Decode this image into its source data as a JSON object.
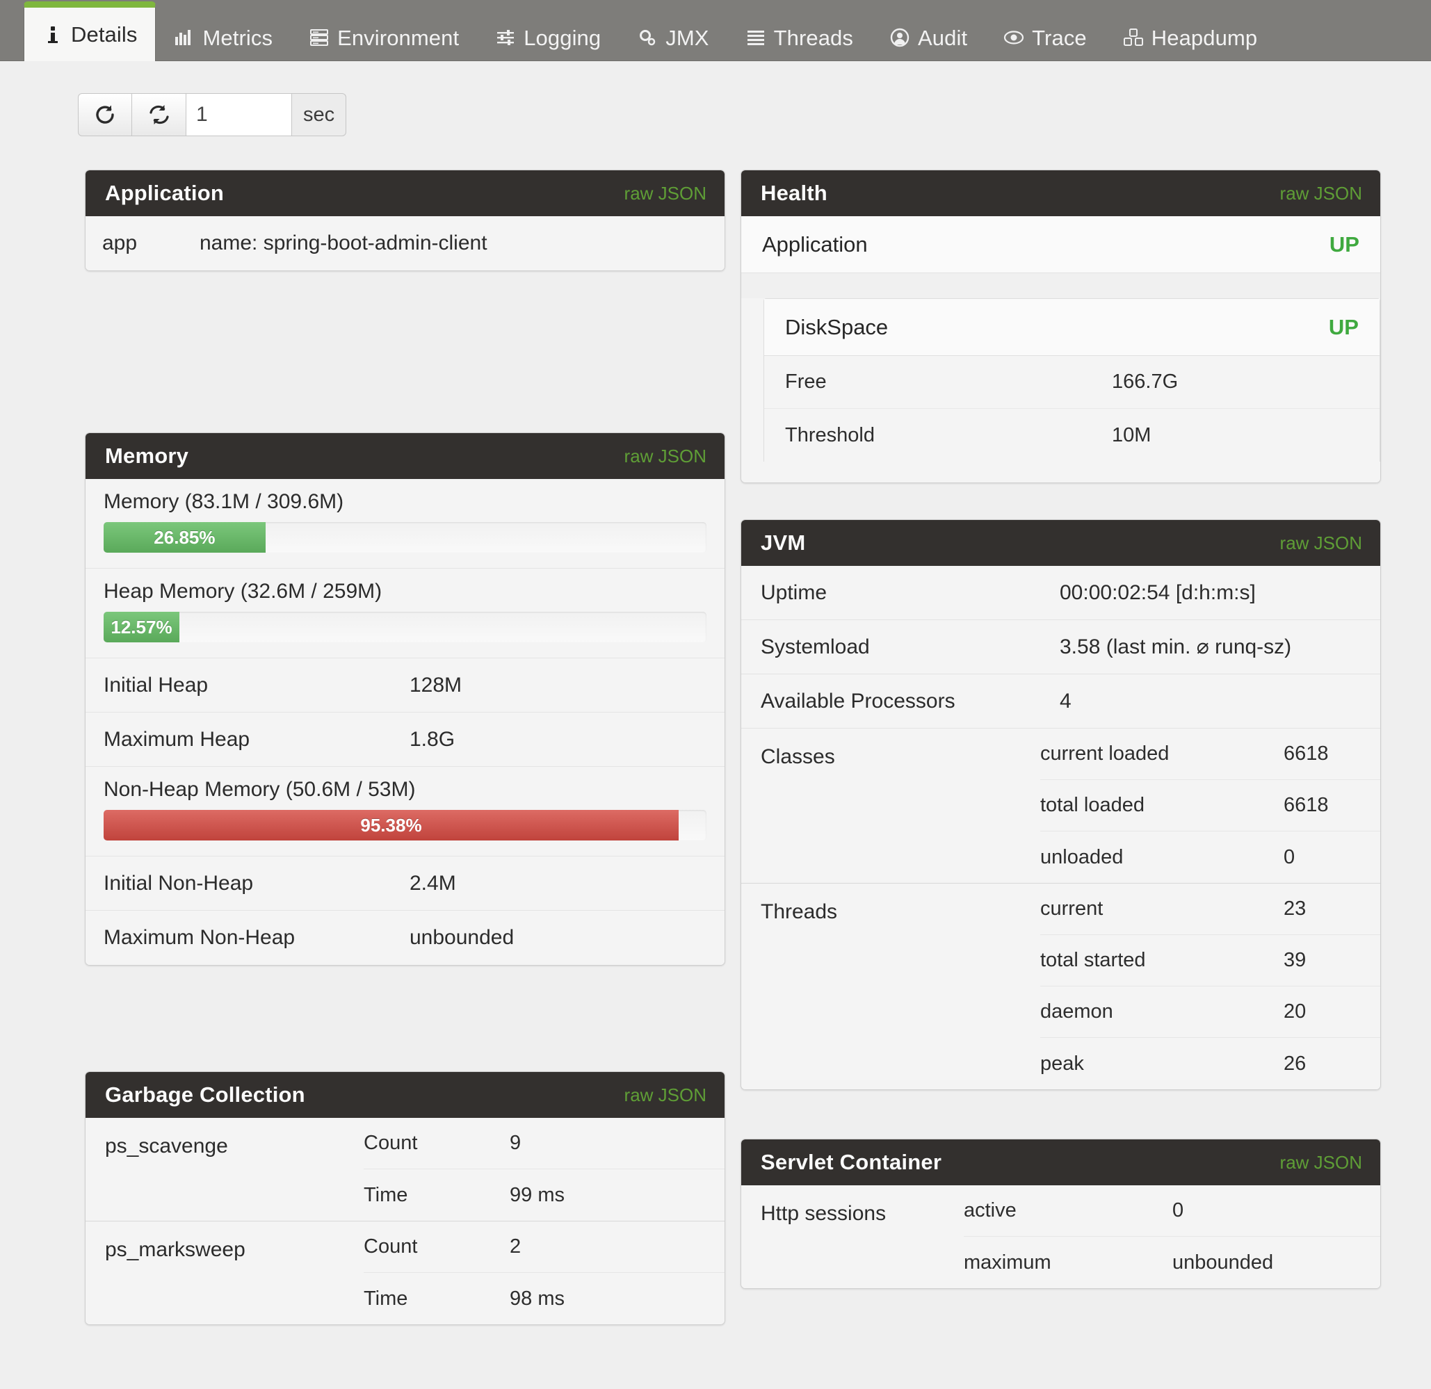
{
  "tabs": [
    {
      "label": "Details",
      "icon": "info-icon",
      "active": true
    },
    {
      "label": "Metrics",
      "icon": "bar-chart-icon",
      "active": false
    },
    {
      "label": "Environment",
      "icon": "server-icon",
      "active": false
    },
    {
      "label": "Logging",
      "icon": "sliders-icon",
      "active": false
    },
    {
      "label": "JMX",
      "icon": "gears-icon",
      "active": false
    },
    {
      "label": "Threads",
      "icon": "list-icon",
      "active": false
    },
    {
      "label": "Audit",
      "icon": "user-circle-icon",
      "active": false
    },
    {
      "label": "Trace",
      "icon": "eye-icon",
      "active": false
    },
    {
      "label": "Heapdump",
      "icon": "cubes-icon",
      "active": false
    }
  ],
  "toolbar": {
    "refresh_icon": "refresh-icon",
    "autorefresh_icon": "auto-refresh-icon",
    "interval_value": "1",
    "interval_placeholder": "1",
    "interval_unit": "sec"
  },
  "raw_json_label": "raw JSON",
  "colors": {
    "accent_green": "#7fb73e",
    "status_up": "#3fa93f",
    "raw_json": "#5f9e36",
    "panel_header": "#33302e",
    "bar_green": "#5aa95a",
    "bar_red": "#c0433c"
  },
  "panels": {
    "application": {
      "title": "Application",
      "row": {
        "key": "app",
        "value": "name: spring-boot-admin-client"
      }
    },
    "health": {
      "title": "Health",
      "application": {
        "label": "Application",
        "status": "UP"
      },
      "diskspace": {
        "label": "DiskSpace",
        "status": "UP",
        "details": [
          {
            "key": "Free",
            "value": "166.7G"
          },
          {
            "key": "Threshold",
            "value": "10M"
          }
        ]
      }
    },
    "memory": {
      "title": "Memory",
      "bars": [
        {
          "label": "Memory (83.1M / 309.6M)",
          "percent_label": "26.85%",
          "percent": 26.85,
          "color": "green"
        },
        {
          "label": "Heap Memory (32.6M / 259M)",
          "percent_label": "12.57%",
          "percent": 12.57,
          "color": "green"
        }
      ],
      "heap_rows": [
        {
          "key": "Initial Heap",
          "value": "128M"
        },
        {
          "key": "Maximum Heap",
          "value": "1.8G"
        }
      ],
      "nonheap_bar": {
        "label": "Non-Heap Memory (50.6M / 53M)",
        "percent_label": "95.38%",
        "percent": 95.38,
        "color": "red"
      },
      "nonheap_rows": [
        {
          "key": "Initial Non-Heap",
          "value": "2.4M"
        },
        {
          "key": "Maximum Non-Heap",
          "value": "unbounded"
        }
      ]
    },
    "jvm": {
      "title": "JVM",
      "rows": [
        {
          "key": "Uptime",
          "value": "00:00:02:54 [d:h:m:s]"
        },
        {
          "key": "Systemload",
          "value": "3.58 (last min. ⌀ runq-sz)"
        },
        {
          "key": "Available Processors",
          "value": "4"
        }
      ],
      "groups": [
        {
          "name": "Classes",
          "lines": [
            {
              "key": "current loaded",
              "value": "6618"
            },
            {
              "key": "total loaded",
              "value": "6618"
            },
            {
              "key": "unloaded",
              "value": "0"
            }
          ]
        },
        {
          "name": "Threads",
          "lines": [
            {
              "key": "current",
              "value": "23"
            },
            {
              "key": "total started",
              "value": "39"
            },
            {
              "key": "daemon",
              "value": "20"
            },
            {
              "key": "peak",
              "value": "26"
            }
          ]
        }
      ]
    },
    "garbage_collection": {
      "title": "Garbage Collection",
      "groups": [
        {
          "name": "ps_scavenge",
          "lines": [
            {
              "key": "Count",
              "value": "9"
            },
            {
              "key": "Time",
              "value": "99 ms"
            }
          ]
        },
        {
          "name": "ps_marksweep",
          "lines": [
            {
              "key": "Count",
              "value": "2"
            },
            {
              "key": "Time",
              "value": "98 ms"
            }
          ]
        }
      ]
    },
    "servlet_container": {
      "title": "Servlet Container",
      "groups": [
        {
          "name": "Http sessions",
          "lines": [
            {
              "key": "active",
              "value": "0"
            },
            {
              "key": "maximum",
              "value": "unbounded"
            }
          ]
        }
      ]
    }
  }
}
